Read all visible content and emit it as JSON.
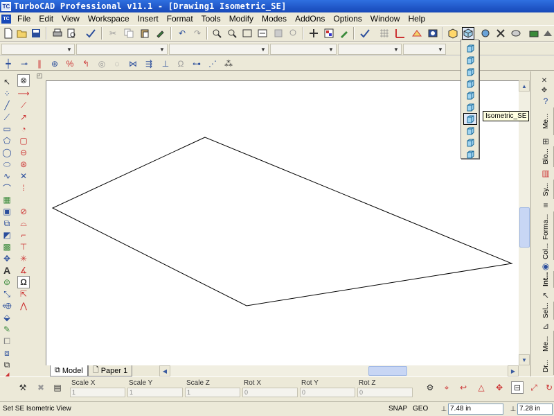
{
  "window": {
    "app_icon_text": "TC",
    "title": "TurboCAD Professional v11.1 - [Drawing1 Isometric_SE]"
  },
  "menubar": {
    "doc_icon_text": "TC",
    "items": [
      "File",
      "Edit",
      "View",
      "Workspace",
      "Insert",
      "Format",
      "Tools",
      "Modify",
      "Modes",
      "AddOns",
      "Options",
      "Window",
      "Help"
    ]
  },
  "view_flyout": {
    "tooltip": "Isometric_SE",
    "selected_index": 6,
    "item_icons": [
      "front-view-icon",
      "back-view-icon",
      "left-view-icon",
      "right-view-icon",
      "top-view-icon",
      "bottom-view-icon",
      "isometric-se-icon",
      "isometric-sw-icon",
      "isometric-ne-icon",
      "isometric-nw-icon"
    ]
  },
  "tabs": {
    "model": "Model",
    "paper": "Paper 1"
  },
  "right_panel": {
    "tabs": [
      "Me...",
      "Blo...",
      "Sy...",
      "Forma...",
      "Col...",
      "Int...",
      "Sel...",
      "Me...",
      "Dr..."
    ]
  },
  "property_bar": {
    "labels": [
      "Scale X",
      "Scale Y",
      "Scale Z",
      "Rot X",
      "Rot Y",
      "Rot Z"
    ],
    "values": [
      "1",
      "1",
      "1",
      "0",
      "0",
      "0"
    ]
  },
  "status_bar": {
    "message": "Set SE Isometric View",
    "snap": "SNAP",
    "geo": "GEO",
    "x_value": "7.48 in",
    "y_value": "7.28 in"
  },
  "colors": {
    "title_bar": "#1748b8",
    "chrome": "#ece9d8",
    "canvas": "#ffffff",
    "tooltip_bg": "#ffffe1"
  }
}
